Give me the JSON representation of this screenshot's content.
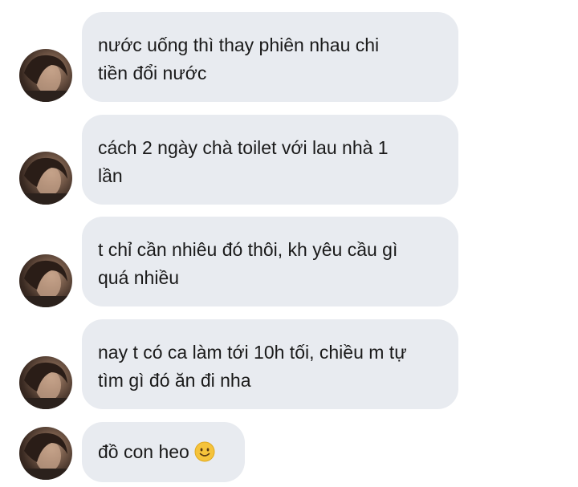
{
  "conversation": {
    "messages": [
      {
        "line1": "nước uống thì thay phiên nhau chi",
        "line2": "tiền đổi nước"
      },
      {
        "line1": "cách 2 ngày chà toilet với lau nhà 1",
        "line2": "lần"
      },
      {
        "line1": "t chỉ cần nhiêu đó thôi, kh yêu cầu gì",
        "line2": "quá nhiều"
      },
      {
        "line1": "nay t có ca làm tới 10h tối, chiều m tự",
        "line2": "tìm gì đó ăn đi nha"
      },
      {
        "line1": "đồ con heo",
        "emoji": "slightly-smiling-face-emoji"
      }
    ]
  },
  "colors": {
    "bubble": "#e8ebf0",
    "text": "#1a1a1a",
    "background": "#ffffff",
    "emoji": "#f5c33b"
  }
}
